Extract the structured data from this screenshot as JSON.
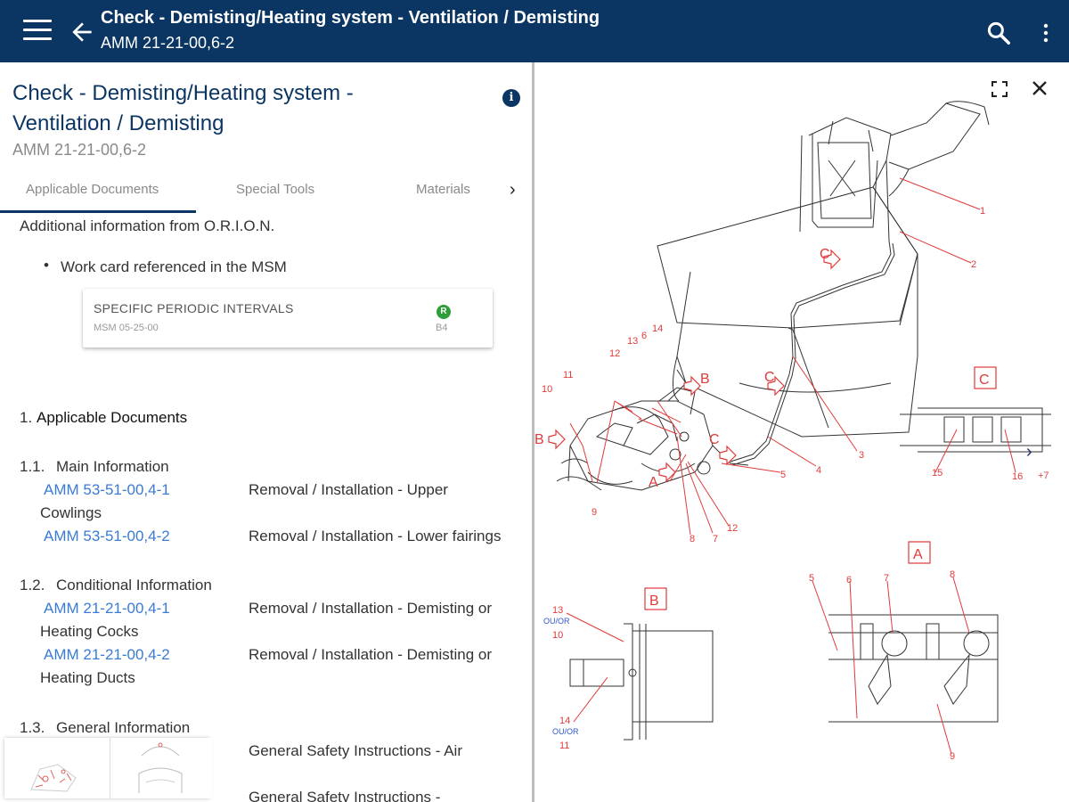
{
  "appbar": {
    "title": "Check - Demisting/Heating system - Ventilation / Demisting",
    "subtitle": "AMM 21-21-00,6-2",
    "menu_icon": "hamburger-menu-icon",
    "back_icon": "arrow-left-icon",
    "search_icon": "search-icon",
    "more_icon": "more-vert-icon"
  },
  "doc": {
    "title_line1": "Check - Demisting/Heating system -",
    "title_line2": "Ventilation / Demisting",
    "subtitle": "AMM 21-21-00,6-2",
    "info_icon": "i"
  },
  "tabs": [
    {
      "label": "Applicable Documents",
      "active": true
    },
    {
      "label": "Special Tools",
      "active": false
    },
    {
      "label": "Materials",
      "active": false
    }
  ],
  "content": {
    "intro": "Additional information from O.R.I.O.N.",
    "bullet": "Work card referenced in the MSM",
    "card": {
      "title": "SPECIFIC PERIODIC INTERVALS",
      "ref": "MSM 05-25-00",
      "badge": "R",
      "code": "B4"
    },
    "section_num": "1.",
    "section_title": "Applicable Documents",
    "s11": "1.1.",
    "s11_title": "Main Information",
    "s11_rows": [
      {
        "ref": "AMM 53-51-00,4-1",
        "desc": "Removal / Installation - Upper",
        "wrap": "Cowlings"
      },
      {
        "ref": "AMM 53-51-00,4-2",
        "desc": "Removal / Installation - Lower fairings",
        "wrap": ""
      }
    ],
    "s12": "1.2.",
    "s12_title": "Conditional Information",
    "s12_rows": [
      {
        "ref": "AMM 21-21-00,4-1",
        "desc": "Removal / Installation - Demisting or",
        "wrap": "Heating Cocks"
      },
      {
        "ref": "AMM 21-21-00,4-2",
        "desc": "Removal / Installation - Demisting or",
        "wrap": "Heating Ducts"
      }
    ],
    "s13": "1.3.",
    "s13_title": "General Information",
    "s13_rows": [
      {
        "desc": "General Safety Instructions - Air"
      },
      {
        "desc": "General Safety Instructions -"
      }
    ]
  },
  "figure": {
    "callouts": [
      "1",
      "2",
      "3",
      "4",
      "5",
      "6",
      "7",
      "8",
      "9",
      "10",
      "11",
      "12",
      "12",
      "13",
      "14",
      "6",
      "7",
      "8",
      "12"
    ],
    "view_labels": {
      "A": "A",
      "B": "B",
      "C": "C"
    },
    "pointers": {
      "B1": "B",
      "B2": "B",
      "C1": "C",
      "C2": "C",
      "C3": "C",
      "A1": "A"
    },
    "detail_c": [
      "15",
      "16"
    ],
    "detail_b": [
      "13",
      "OU/OR",
      "10",
      "14",
      "OU/OR",
      "11"
    ],
    "detail_a": [
      "5",
      "6",
      "7",
      "8",
      "9"
    ],
    "more_count": "+7",
    "fullscreen_icon": "fullscreen-icon",
    "close_icon": "close-icon",
    "next_icon": "chevron-right-icon"
  }
}
